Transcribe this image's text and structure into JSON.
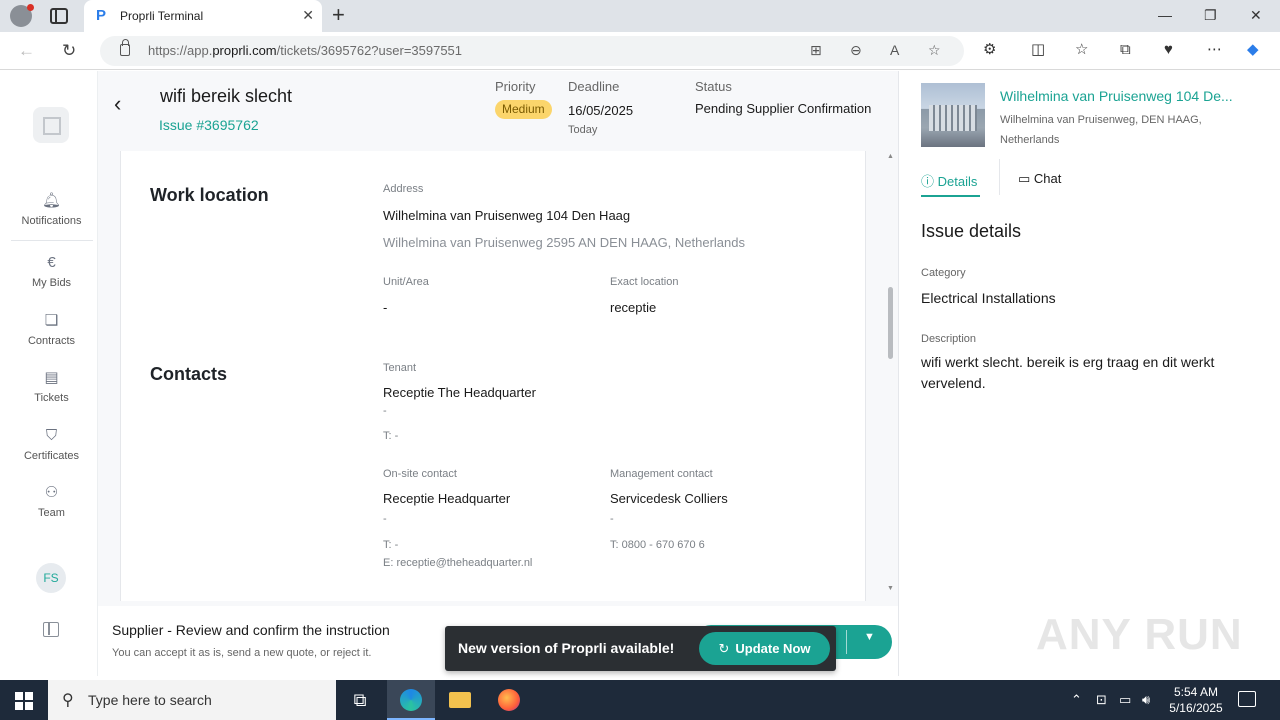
{
  "browser": {
    "tab_title": "Proprli Terminal",
    "tab_favicon": "P",
    "url_prefix": "https://app.",
    "url_domain": "proprli.com",
    "url_path": "/tickets/3695762?user=3597551"
  },
  "nav": {
    "items": [
      {
        "label": "Notifications",
        "icon": "bell-icon"
      },
      {
        "label": "My Bids",
        "icon": "euro-icon"
      },
      {
        "label": "Contracts",
        "icon": "document-icon"
      },
      {
        "label": "Tickets",
        "icon": "clipboard-icon"
      },
      {
        "label": "Certificates",
        "icon": "shield-check-icon"
      },
      {
        "label": "Team",
        "icon": "team-icon"
      }
    ],
    "avatar_initials": "FS"
  },
  "header": {
    "title": "wifi bereik slecht",
    "issue_id": "Issue #3695762",
    "priority_label": "Priority",
    "priority_value": "Medium",
    "deadline_label": "Deadline",
    "deadline_value": "16/05/2025",
    "deadline_sub": "Today",
    "status_label": "Status",
    "status_value": "Pending Supplier Confirmation"
  },
  "work_location": {
    "title": "Work location",
    "address_label": "Address",
    "address_line1": "Wilhelmina van Pruisenweg 104 Den Haag",
    "address_line2": "Wilhelmina van Pruisenweg 2595 AN DEN HAAG, Netherlands",
    "unit_label": "Unit/Area",
    "unit_value": "-",
    "exact_label": "Exact location",
    "exact_value": "receptie"
  },
  "contacts": {
    "title": "Contacts",
    "tenant": {
      "label": "Tenant",
      "name": "Receptie The Headquarter",
      "sub": "-",
      "phone": "T: -"
    },
    "onsite": {
      "label": "On-site contact",
      "name": "Receptie Headquarter",
      "sub": "-",
      "phone": "T: -",
      "email": "E: receptie@theheadquarter.nl"
    },
    "management": {
      "label": "Management contact",
      "name": "Servicedesk Colliers",
      "sub": "-",
      "phone": "T: 0800 - 670 670 6"
    }
  },
  "bottom_bar": {
    "title": "Supplier - Review and confirm the instruction",
    "subtitle": "You can accept it as is, send a new quote, or reject it."
  },
  "toast": {
    "message": "New version of Proprli available!",
    "button": "Update Now"
  },
  "right_panel": {
    "property_name": "Wilhelmina van Pruisenweg 104 De...",
    "property_address": "Wilhelmina van Pruisenweg, DEN HAAG, Netherlands",
    "tabs": {
      "details": "Details",
      "chat": "Chat"
    },
    "heading": "Issue details",
    "category_label": "Category",
    "category_value": "Electrical Installations",
    "description_label": "Description",
    "description_value": "wifi werkt slecht. bereik is erg traag en dit werkt vervelend."
  },
  "taskbar": {
    "search_placeholder": "Type here to search",
    "time": "5:54 AM",
    "date": "5/16/2025"
  },
  "watermark": "ANY RUN",
  "colors": {
    "accent": "#1ba393",
    "priority_badge": "#fbd56b",
    "toast_bg": "#2b2f33",
    "taskbar_bg": "#1e2a3a"
  }
}
